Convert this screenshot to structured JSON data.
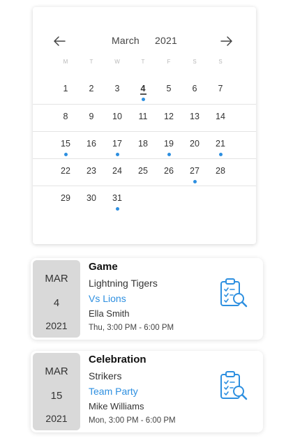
{
  "calendar": {
    "month": "March",
    "year": "2021",
    "prev_icon": "arrow-left-icon",
    "next_icon": "arrow-right-icon",
    "weekdays": [
      "M",
      "T",
      "W",
      "T",
      "F",
      "S",
      "S"
    ],
    "weeks": [
      [
        {
          "n": "1"
        },
        {
          "n": "2"
        },
        {
          "n": "3"
        },
        {
          "n": "4",
          "today": true,
          "dot": true
        },
        {
          "n": "5"
        },
        {
          "n": "6"
        },
        {
          "n": "7"
        }
      ],
      [
        {
          "n": "8"
        },
        {
          "n": "9"
        },
        {
          "n": "10"
        },
        {
          "n": "11"
        },
        {
          "n": "12"
        },
        {
          "n": "13"
        },
        {
          "n": "14"
        }
      ],
      [
        {
          "n": "15",
          "dot": true
        },
        {
          "n": "16"
        },
        {
          "n": "17",
          "dot": true
        },
        {
          "n": "18"
        },
        {
          "n": "19",
          "dot": true
        },
        {
          "n": "20"
        },
        {
          "n": "21",
          "dot": true
        }
      ],
      [
        {
          "n": "22"
        },
        {
          "n": "23"
        },
        {
          "n": "24"
        },
        {
          "n": "25"
        },
        {
          "n": "26"
        },
        {
          "n": "27",
          "dot": true
        },
        {
          "n": "28"
        }
      ],
      [
        {
          "n": "29"
        },
        {
          "n": "30"
        },
        {
          "n": "31",
          "dot": true
        }
      ]
    ],
    "dot_color": "#2d8fe0"
  },
  "events": [
    {
      "month": "MAR",
      "day": "4",
      "year": "2021",
      "title": "Game",
      "team": "Lightning Tigers",
      "opponent": "Vs Lions",
      "person": "Ella Smith",
      "time": "Thu, 3:00 PM - 6:00 PM",
      "icon": "clipboard-search-icon"
    },
    {
      "month": "MAR",
      "day": "15",
      "year": "2021",
      "title": "Celebration",
      "team": "Strikers",
      "opponent": "Team Party",
      "person": "Mike Williams",
      "time": "Mon, 3:00 PM - 6:00 PM",
      "icon": "clipboard-search-icon"
    }
  ],
  "colors": {
    "accent": "#2d8fe0",
    "date_box": "#d9d9d9"
  }
}
